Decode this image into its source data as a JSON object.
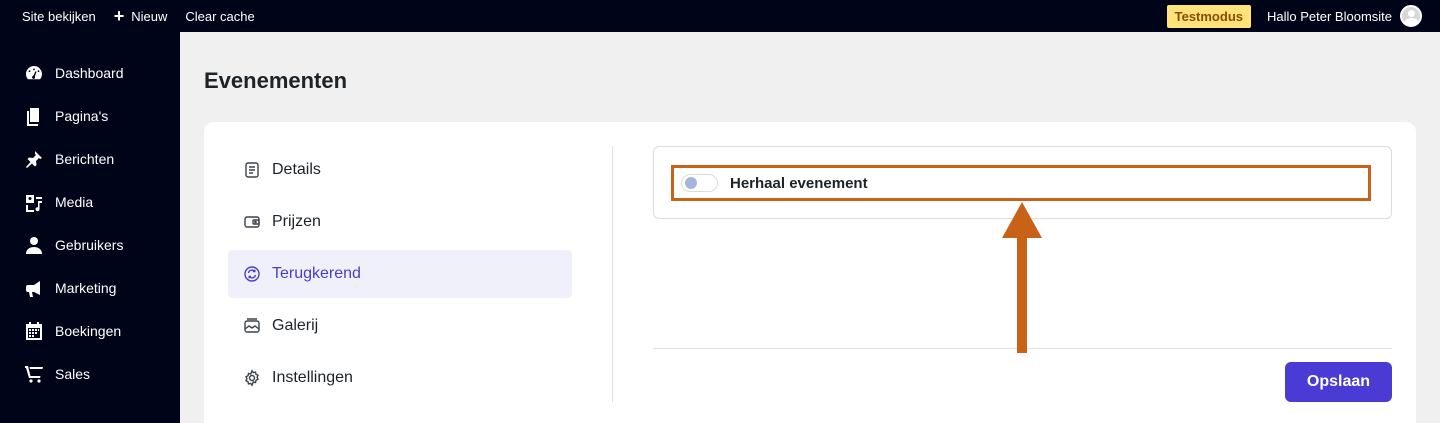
{
  "topbar": {
    "view_site": "Site bekijken",
    "new_label": "Nieuw",
    "clear_cache": "Clear cache",
    "mode_badge": "Testmodus",
    "greeting": "Hallo Peter Bloomsite"
  },
  "sidebar": {
    "items": [
      {
        "label": "Dashboard",
        "icon": "dashboard-icon"
      },
      {
        "label": "Pagina's",
        "icon": "pages-icon"
      },
      {
        "label": "Berichten",
        "icon": "pin-icon"
      },
      {
        "label": "Media",
        "icon": "media-icon"
      },
      {
        "label": "Gebruikers",
        "icon": "user-icon"
      },
      {
        "label": "Marketing",
        "icon": "megaphone-icon"
      },
      {
        "label": "Boekingen",
        "icon": "calendar-icon"
      },
      {
        "label": "Sales",
        "icon": "cart-icon"
      }
    ]
  },
  "main": {
    "title": "Evenementen",
    "tabs": [
      {
        "label": "Details",
        "icon": "document-icon"
      },
      {
        "label": "Prijzen",
        "icon": "wallet-icon"
      },
      {
        "label": "Terugkerend",
        "icon": "refresh-icon",
        "active": true
      },
      {
        "label": "Galerij",
        "icon": "gallery-icon"
      },
      {
        "label": "Instellingen",
        "icon": "gear-icon"
      }
    ],
    "repeat_toggle": {
      "label": "Herhaal evenement",
      "checked": false
    },
    "save_label": "Opslaan"
  },
  "colors": {
    "accent": "#4a3bd4",
    "admin_bar": "#000418",
    "highlight_annotation": "#c96219",
    "badge_bg": "#ffe27a"
  }
}
